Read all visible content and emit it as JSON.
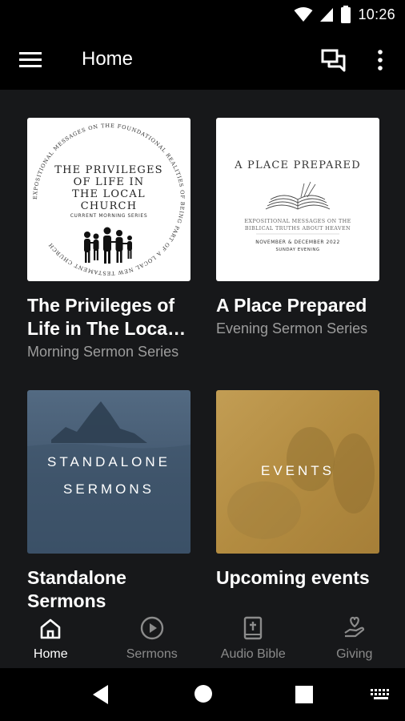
{
  "status": {
    "time": "10:26"
  },
  "app_bar": {
    "title": "Home"
  },
  "cards": [
    {
      "title": "The Privileges of Life in The Local Church",
      "subtitle": "Morning Sermon Series",
      "art": {
        "line1": "THE PRIVILEGES",
        "line2": "OF LIFE IN",
        "line3": "THE LOCAL",
        "line4": "CHURCH",
        "line5": "CURRENT MORNING SERIES",
        "ring": "EXPOSITIONAL MESSAGES ON THE FOUNDATIONAL REALITIES OF BEING PART OF A LOCAL NEW TESTAMENT CHURCH"
      }
    },
    {
      "title": "A Place Prepared",
      "subtitle": "Evening Sermon Series",
      "art": {
        "heading": "A PLACE PREPARED",
        "sub1": "EXPOSITIONAL MESSAGES ON THE",
        "sub2": "BIBLICAL TRUTHS ABOUT HEAVEN",
        "date1": "NOVEMBER & DECEMBER 2022",
        "date2": "SUNDAY EVENING"
      }
    },
    {
      "title": "Standalone Sermons",
      "subtitle": "",
      "art": {
        "line1": "STANDALONE",
        "line2": "SERMONS"
      }
    },
    {
      "title": "Upcoming events",
      "subtitle": "",
      "art": {
        "line1": "EVENTS"
      }
    }
  ],
  "nav": [
    {
      "label": "Home",
      "icon": "home-icon",
      "active": true
    },
    {
      "label": "Sermons",
      "icon": "play-circle-icon",
      "active": false
    },
    {
      "label": "Audio Bible",
      "icon": "bible-icon",
      "active": false
    },
    {
      "label": "Giving",
      "icon": "giving-icon",
      "active": false
    }
  ],
  "colors": {
    "background": "#17181a",
    "bar": "#000000",
    "inactive": "#8b8b8b",
    "subtitle": "#9d9d9d"
  }
}
